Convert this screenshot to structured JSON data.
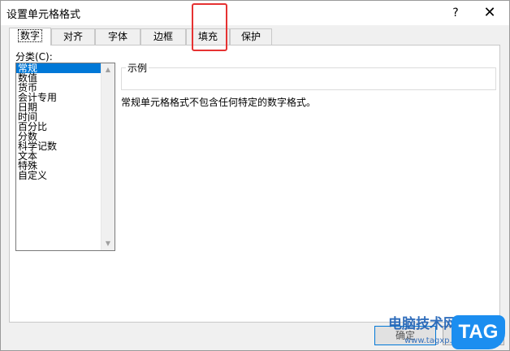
{
  "dialog": {
    "title": "设置单元格格式",
    "help": "?",
    "close": "✕"
  },
  "tabs": [
    {
      "label": "数字",
      "active": true
    },
    {
      "label": "对齐",
      "active": false
    },
    {
      "label": "字体",
      "active": false
    },
    {
      "label": "边框",
      "active": false
    },
    {
      "label": "填充",
      "active": false
    },
    {
      "label": "保护",
      "active": false
    }
  ],
  "category": {
    "label": "分类(C):",
    "items": [
      "常规",
      "数值",
      "货币",
      "会计专用",
      "日期",
      "时间",
      "百分比",
      "分数",
      "科学记数",
      "文本",
      "特殊",
      "自定义"
    ],
    "selected": "常规"
  },
  "sample": {
    "legend": "示例",
    "value": ""
  },
  "description": "常规单元格格式不包含任何特定的数字格式。",
  "buttons": {
    "ok": "确定",
    "cancel": ""
  },
  "watermark": {
    "site": "电脑技术网",
    "url": "www.tagxp.com",
    "logo": "TAG"
  },
  "colors": {
    "highlight": "#e63232",
    "selection": "#0078d7"
  }
}
